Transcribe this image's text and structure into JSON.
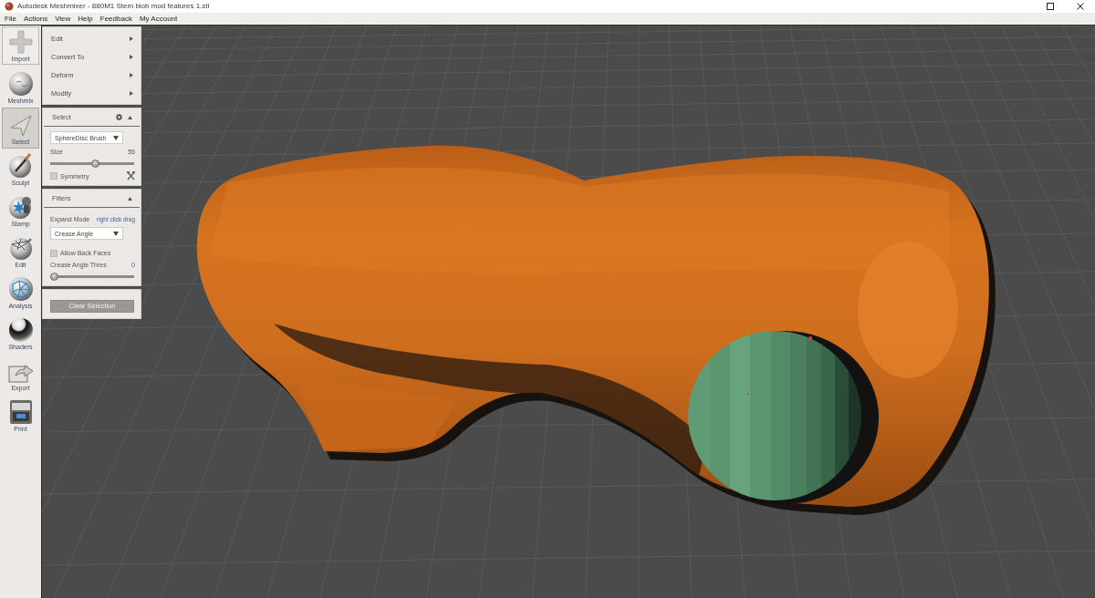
{
  "window": {
    "title": "Autodesk Meshmixer - 880M1 Stem blob mod features 1.stl"
  },
  "menu_bar": [
    "File",
    "Actions",
    "View",
    "Help",
    "Feedback",
    "My Account"
  ],
  "import_button": {
    "label": "Import"
  },
  "tools": [
    {
      "label": "Meshmix",
      "selected": false
    },
    {
      "label": "Select",
      "selected": true
    },
    {
      "label": "Sculpt",
      "selected": false
    },
    {
      "label": "Stamp",
      "selected": false
    },
    {
      "label": "Edit",
      "selected": false
    },
    {
      "label": "Analysis",
      "selected": false
    },
    {
      "label": "Shaders",
      "selected": false
    },
    {
      "label": "Export",
      "selected": false
    },
    {
      "label": "Print",
      "selected": false
    }
  ],
  "actions_menu": [
    "Edit",
    "Convert To",
    "Deform",
    "Modify"
  ],
  "select_panel": {
    "title": "Select",
    "brush": "SphereDisc Brush",
    "size": {
      "label": "Size",
      "reading": "55",
      "level": 0.54
    },
    "symmetry": {
      "label": "Symmetry",
      "checked": false
    }
  },
  "filters_panel": {
    "title": "Filters",
    "expand_mode": {
      "label": "Expand Mode",
      "hint": "right click drag"
    },
    "mode": "Crease Angle",
    "allow_back_faces": {
      "label": "Allow Back Faces",
      "checked": false
    },
    "crease_angle": {
      "label": "Crease Angle Thres",
      "reading": "0",
      "level": 0
    }
  },
  "clear_button": "Clear Selection"
}
